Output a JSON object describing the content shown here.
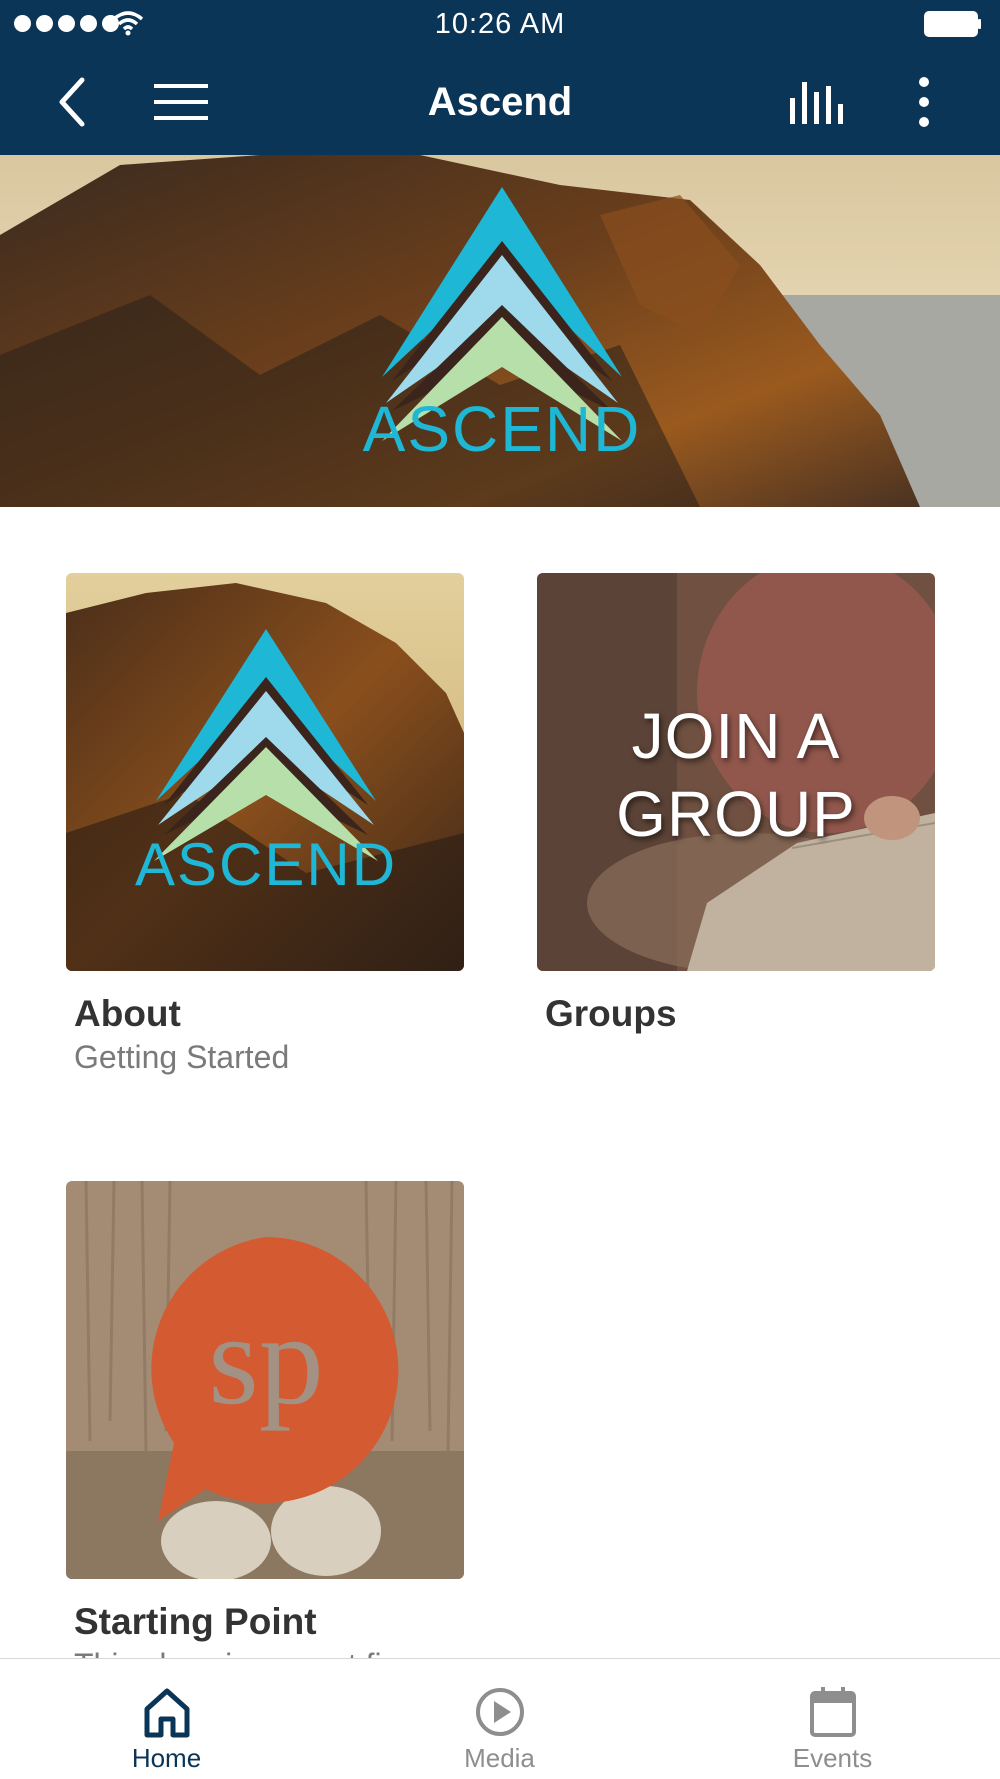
{
  "status_bar": {
    "time": "10:26 AM",
    "signal_icon": "signal-dots-icon",
    "wifi_icon": "wifi-icon",
    "battery_icon": "battery-icon"
  },
  "nav_bar": {
    "title": "Ascend",
    "back_icon": "chevron-left-icon",
    "menu_icon": "hamburger-menu-icon",
    "stats_icon": "equalizer-bars-icon",
    "more_icon": "vertical-dots-icon",
    "background_color": "#0b3557"
  },
  "hero": {
    "logo_text": "ASCEND"
  },
  "tiles": [
    {
      "title": "About",
      "subtitle": "Getting Started",
      "image_text": "ASCEND"
    },
    {
      "title": "Groups",
      "subtitle": "",
      "image_text_line1": "JOIN A",
      "image_text_line2": "GROUP"
    },
    {
      "title": "Starting Point",
      "subtitle": "This class is a great fi...",
      "image_text": "sp"
    }
  ],
  "tab_bar": {
    "items": [
      {
        "label": "Home",
        "icon": "home-icon",
        "active": true
      },
      {
        "label": "Media",
        "icon": "play-circle-icon",
        "active": false
      },
      {
        "label": "Events",
        "icon": "calendar-icon",
        "active": false
      }
    ],
    "active_color": "#0b3557",
    "inactive_color": "#8e8e8e"
  },
  "colors": {
    "logo_teal": "#1fb7d6",
    "logo_light_blue": "#9fd9ec",
    "logo_green": "#b6dfaa",
    "sp_orange": "#d45a32"
  }
}
